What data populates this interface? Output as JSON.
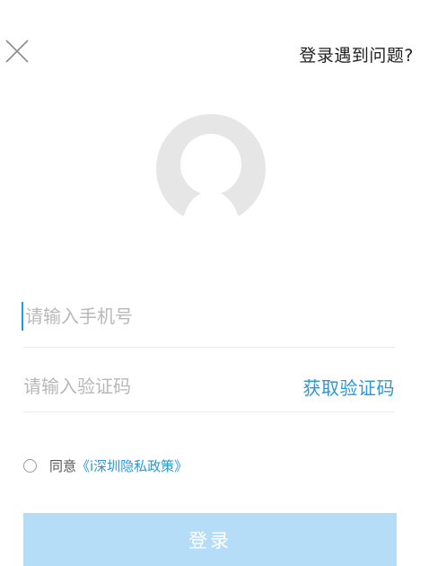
{
  "header": {
    "close_icon": "close-icon",
    "help_link_label": "登录遇到问题?"
  },
  "avatar": {
    "icon": "default-avatar-icon",
    "color": "#e6e6e6"
  },
  "form": {
    "phone_placeholder": "请输入手机号",
    "phone_value": "",
    "code_placeholder": "请输入验证码",
    "code_value": "",
    "get_code_label": "获取验证码"
  },
  "agreement": {
    "checked": false,
    "prefix": "同意",
    "policy_link": "《i深圳隐私政策》"
  },
  "login_button_label": "登录",
  "colors": {
    "accent": "#2a97d6",
    "button_disabled": "#b6ddf8",
    "placeholder": "#b8b8b8"
  }
}
